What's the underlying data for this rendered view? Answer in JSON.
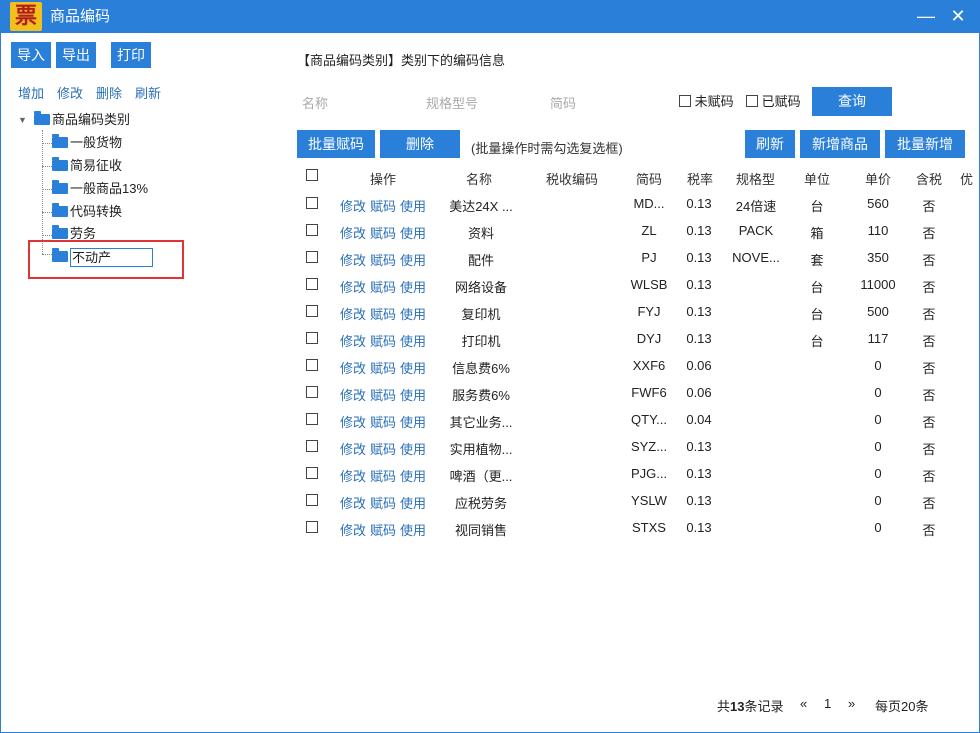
{
  "window": {
    "logo_char": "票",
    "title": "商品编码",
    "minimize": "—",
    "close": "✕"
  },
  "toolbar": {
    "import": "导入",
    "export": "导出",
    "print": "打印"
  },
  "tree_actions": {
    "add": "增加",
    "edit": "修改",
    "delete": "删除",
    "refresh": "刷新"
  },
  "tree": {
    "root": "商品编码类别",
    "toggle": "▼",
    "children": [
      "一般货物",
      "简易征收",
      "一般商品13%",
      "代码转换",
      "劳务"
    ],
    "editing_value": "不动产"
  },
  "main": {
    "section_title": "【商品编码类别】类别下的编码信息",
    "filters": {
      "name_placeholder": "名称",
      "spec_placeholder": "规格型号",
      "short_placeholder": "简码",
      "unassigned": "未赋码",
      "assigned": "已赋码",
      "query": "查询"
    },
    "actions": {
      "batch_assign": "批量赋码",
      "delete": "删除",
      "hint": "(批量操作时需勾选复选框)",
      "refresh": "刷新",
      "add_product": "新增商品",
      "batch_add": "批量新增"
    },
    "columns": [
      "操作",
      "名称",
      "税收编码",
      "简码",
      "税率",
      "规格型",
      "单位",
      "单价",
      "含税",
      "优"
    ],
    "row_actions": [
      "修改",
      "赋码",
      "使用"
    ],
    "rows": [
      {
        "name": "美达24X ...",
        "tax_code": "",
        "short": "MD...",
        "rate": "0.13",
        "spec": "24倍速",
        "unit": "台",
        "price": "560",
        "tax_incl": "否"
      },
      {
        "name": "资料",
        "tax_code": "",
        "short": "ZL",
        "rate": "0.13",
        "spec": "PACK",
        "unit": "箱",
        "price": "110",
        "tax_incl": "否"
      },
      {
        "name": "配件",
        "tax_code": "",
        "short": "PJ",
        "rate": "0.13",
        "spec": "NOVE...",
        "unit": "套",
        "price": "350",
        "tax_incl": "否"
      },
      {
        "name": "网络设备",
        "tax_code": "",
        "short": "WLSB",
        "rate": "0.13",
        "spec": "",
        "unit": "台",
        "price": "11000",
        "tax_incl": "否"
      },
      {
        "name": "复印机",
        "tax_code": "",
        "short": "FYJ",
        "rate": "0.13",
        "spec": "",
        "unit": "台",
        "price": "500",
        "tax_incl": "否"
      },
      {
        "name": "打印机",
        "tax_code": "",
        "short": "DYJ",
        "rate": "0.13",
        "spec": "",
        "unit": "台",
        "price": "117",
        "tax_incl": "否"
      },
      {
        "name": "信息费6%",
        "tax_code": "",
        "short": "XXF6",
        "rate": "0.06",
        "spec": "",
        "unit": "",
        "price": "0",
        "tax_incl": "否"
      },
      {
        "name": "服务费6%",
        "tax_code": "",
        "short": "FWF6",
        "rate": "0.06",
        "spec": "",
        "unit": "",
        "price": "0",
        "tax_incl": "否"
      },
      {
        "name": "其它业务...",
        "tax_code": "",
        "short": "QTY...",
        "rate": "0.04",
        "spec": "",
        "unit": "",
        "price": "0",
        "tax_incl": "否"
      },
      {
        "name": "实用植物...",
        "tax_code": "",
        "short": "SYZ...",
        "rate": "0.13",
        "spec": "",
        "unit": "",
        "price": "0",
        "tax_incl": "否"
      },
      {
        "name": "啤酒（更...",
        "tax_code": "",
        "short": "PJG...",
        "rate": "0.13",
        "spec": "",
        "unit": "",
        "price": "0",
        "tax_incl": "否"
      },
      {
        "name": "应税劳务",
        "tax_code": "",
        "short": "YSLW",
        "rate": "0.13",
        "spec": "",
        "unit": "",
        "price": "0",
        "tax_incl": "否"
      },
      {
        "name": "视同销售",
        "tax_code": "",
        "short": "STXS",
        "rate": "0.13",
        "spec": "",
        "unit": "",
        "price": "0",
        "tax_incl": "否"
      }
    ]
  },
  "pagination": {
    "total_prefix": "共",
    "total": "13",
    "total_suffix": "条记录",
    "prev": "«",
    "page": "1",
    "next": "»",
    "page_size_label": "每页20条"
  },
  "colors": {
    "accent": "#2a7fd9",
    "link": "#2a6fb8",
    "highlight_box": "#e03535",
    "logo_bg": "#f2c01c"
  }
}
